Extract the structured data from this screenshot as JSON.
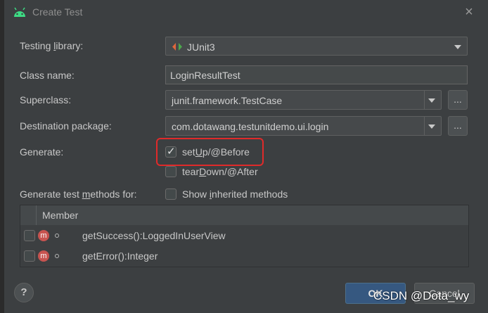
{
  "window": {
    "title": "Create Test",
    "icon": "android-icon",
    "close": "×"
  },
  "form": {
    "testing_library": {
      "label_pre": "Testing ",
      "label_mn": "l",
      "label_post": "ibrary:",
      "value": "JUnit3"
    },
    "class_name": {
      "label": "Class name:",
      "value": "LoginResultTest"
    },
    "superclass": {
      "label": "Superclass:",
      "value": "junit.framework.TestCase",
      "browse": "..."
    },
    "destination_package": {
      "label": "Destination package:",
      "value": "com.dotawang.testunitdemo.ui.login",
      "browse": "..."
    },
    "generate": {
      "label": "Generate:",
      "setup": {
        "pre": "set",
        "mn": "U",
        "post": "p/@Before",
        "checked": true
      },
      "teardown": {
        "pre": "tear",
        "mn": "D",
        "post": "own/@After",
        "checked": false
      }
    },
    "generate_methods": {
      "label_pre": "Generate test ",
      "label_mn": "m",
      "label_post": "ethods for:",
      "show_inherited": {
        "pre": "Show ",
        "mn": "i",
        "post": "nherited methods",
        "checked": false
      }
    }
  },
  "table": {
    "header": "Member",
    "rows": [
      {
        "badge": "m",
        "method": "getSuccess():LoggedInUserView",
        "checked": false
      },
      {
        "badge": "m",
        "method": "getError():Integer",
        "checked": false
      }
    ]
  },
  "buttons": {
    "help": "?",
    "ok": "OK",
    "cancel": "Cancel"
  },
  "watermark": "CSDN @Dota_wy",
  "colors": {
    "accent_ok": "#365880",
    "highlight": "#e02a2a",
    "method_badge": "#c75450"
  }
}
